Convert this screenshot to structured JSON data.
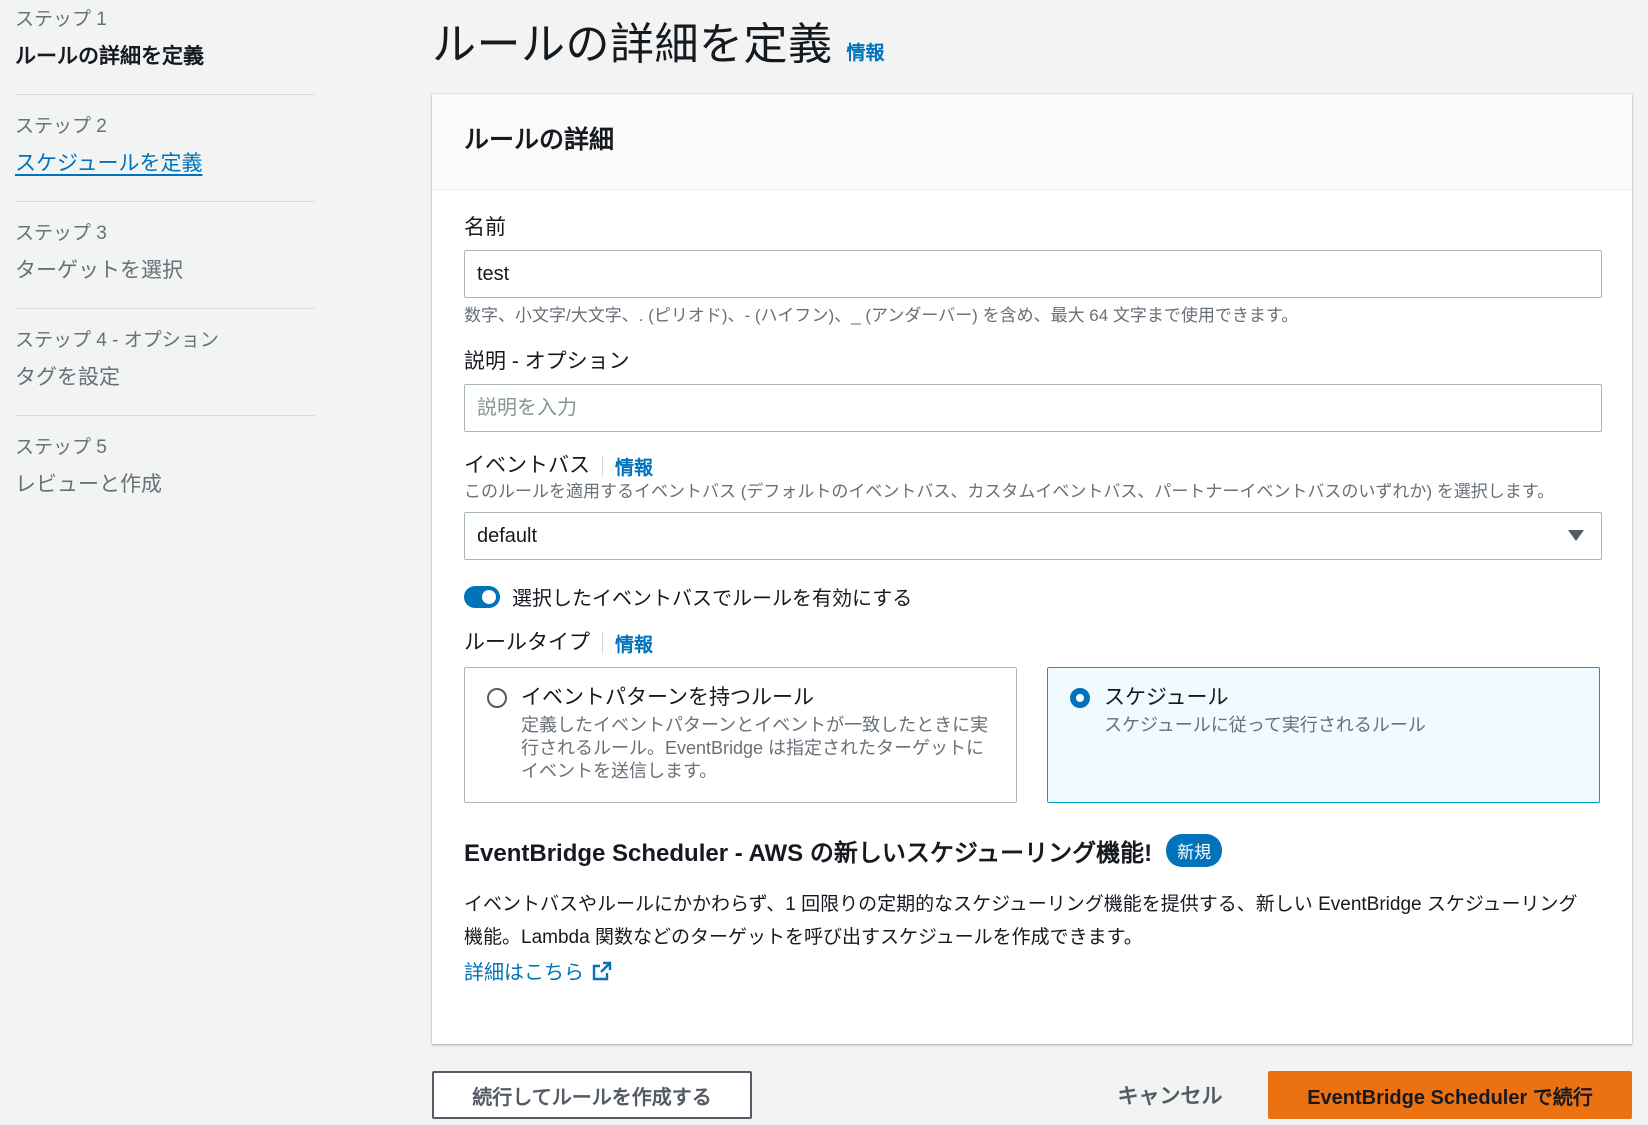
{
  "sidebar": {
    "steps": [
      {
        "num": "ステップ 1",
        "title": "ルールの詳細を定義"
      },
      {
        "num": "ステップ 2",
        "title": "スケジュールを定義"
      },
      {
        "num": "ステップ 3",
        "title": "ターゲットを選択"
      },
      {
        "num": "ステップ 4 - オプション",
        "title": "タグを設定"
      },
      {
        "num": "ステップ 5",
        "title": "レビューと作成"
      }
    ]
  },
  "header": {
    "title": "ルールの詳細を定義",
    "info": "情報"
  },
  "panel": {
    "title": "ルールの詳細",
    "name": {
      "label": "名前",
      "value": "test",
      "hint": "数字、小文字/大文字、. (ピリオド)、- (ハイフン)、_ (アンダーバー) を含め、最大 64 文字まで使用できます。"
    },
    "description": {
      "label": "説明 - オプション",
      "placeholder": "説明を入力"
    },
    "event_bus": {
      "label": "イベントバス",
      "info": "情報",
      "hint": "このルールを適用するイベントバス (デフォルトのイベントバス、カスタムイベントバス、パートナーイベントバスのいずれか) を選択します。",
      "value": "default"
    },
    "toggle_label": "選択したイベントバスでルールを有効にする",
    "rule_type": {
      "label": "ルールタイプ",
      "info": "情報",
      "options": [
        {
          "title": "イベントパターンを持つルール",
          "desc": "定義したイベントパターンとイベントが一致したときに実行されるルール。EventBridge は指定されたターゲットにイベントを送信します。"
        },
        {
          "title": "スケジュール",
          "desc": "スケジュールに従って実行されるルール"
        }
      ]
    },
    "promo": {
      "title": "EventBridge Scheduler - AWS の新しいスケジューリング機能!",
      "badge": "新規",
      "body": "イベントバスやルールにかかわらず、1 回限りの定期的なスケジューリング機能を提供する、新しい EventBridge スケジューリング機能。Lambda 関数などのターゲットを呼び出すスケジュールを作成できます。",
      "link": "詳細はこちら"
    }
  },
  "footer": {
    "secondary": "続行してルールを作成する",
    "cancel": "キャンセル",
    "primary": "EventBridge Scheduler で続行"
  },
  "colors": {
    "accent": "#0073bb",
    "primary_button": "#ec7211"
  },
  "icons": {
    "external_link": "external-link-icon",
    "select_caret": "caret-down-icon"
  }
}
